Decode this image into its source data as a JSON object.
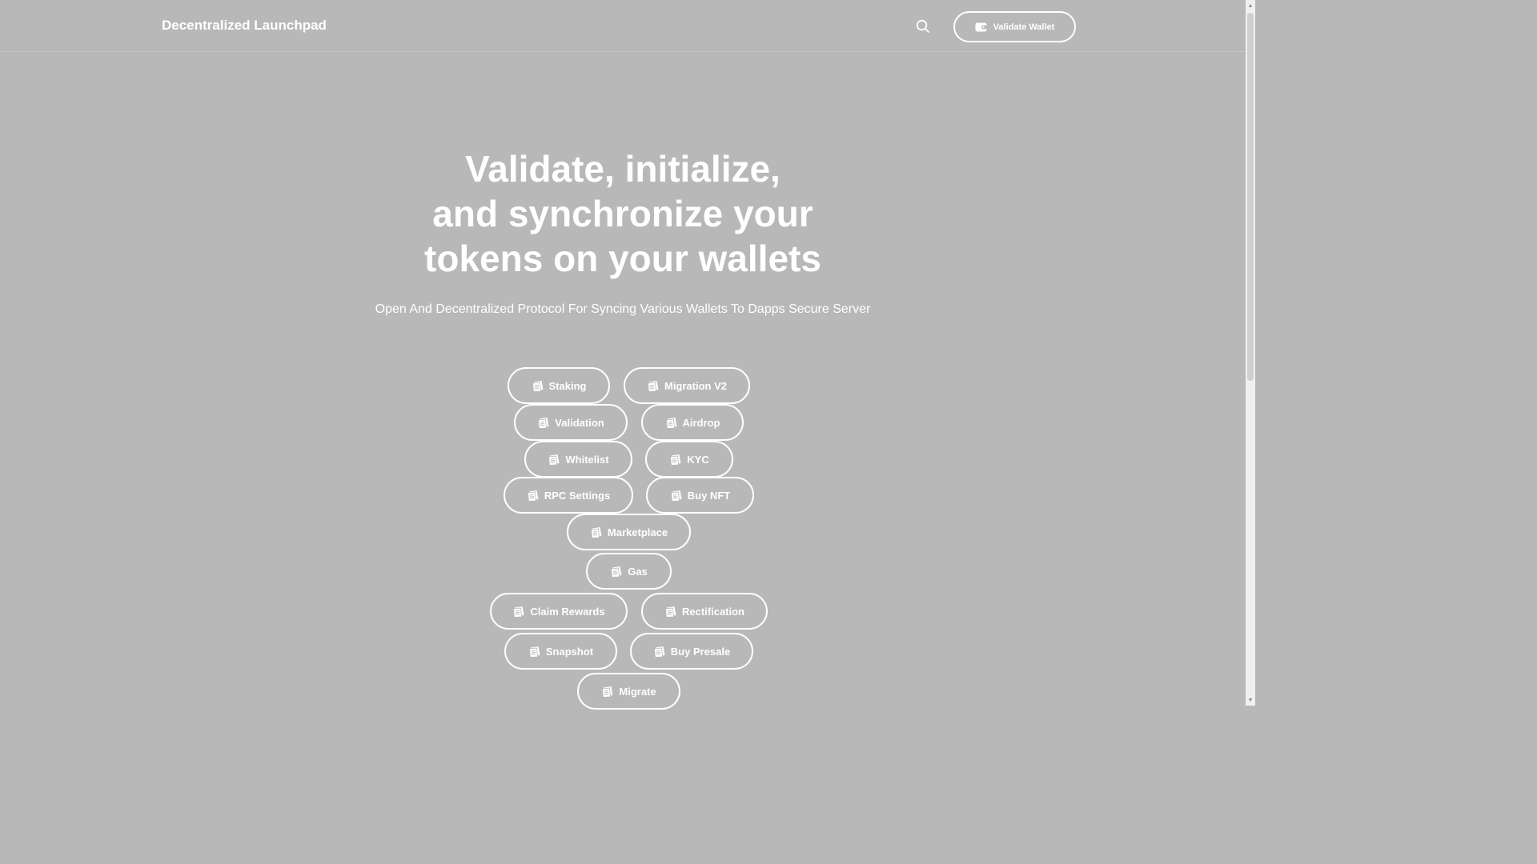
{
  "header": {
    "brand": "Decentralized Launchpad",
    "search_icon": "search-icon",
    "wallet_button": "Validate Wallet",
    "wallet_icon": "wallet-icon"
  },
  "hero": {
    "title_lines": [
      "Validate, initialize,",
      "and synchronize your",
      "tokens on your wallets"
    ],
    "subtitle": "Open And Decentralized Protocol For Syncing Various Wallets To Dapps Secure Server"
  },
  "actions": {
    "icon": "document-icon",
    "items": [
      "Staking",
      "Migration V2",
      "Validation",
      "Airdrop",
      "Whitelist",
      "KYC",
      "RPC Settings",
      "Buy NFT",
      "Marketplace",
      "Gas",
      "Claim Rewards",
      "Rectification",
      "Snapshot",
      "Buy Presale",
      "Migrate"
    ]
  },
  "colors": {
    "background": "#b8b8b8",
    "foreground": "#ffffff"
  }
}
